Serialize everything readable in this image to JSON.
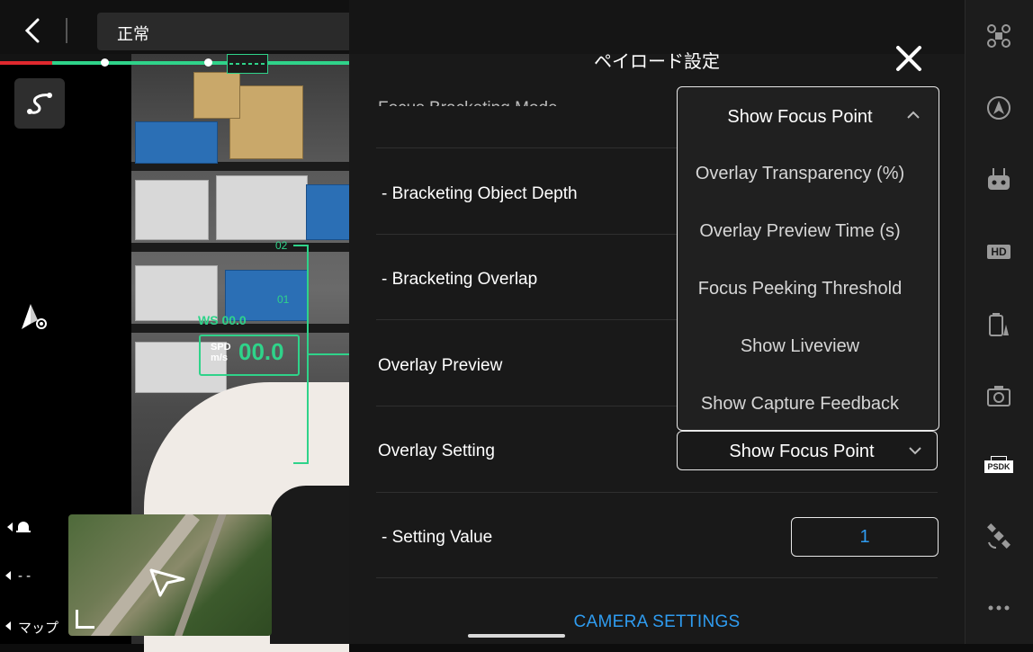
{
  "topbar": {
    "status": "正常"
  },
  "hud": {
    "wind_speed": "WS 00.0",
    "speed_label_line1": "SPD",
    "speed_label_line2": "m/s",
    "speed_value": "00.0",
    "alt_tick_top": "02",
    "alt_tick_mid": "01"
  },
  "left_labels": {
    "dashes": "- -",
    "map": "マップ"
  },
  "modal": {
    "title": "ペイロード設定",
    "rows": {
      "focus_bracketing_mode": "Focus Bracketing Mode",
      "bracketing_object_depth": "- Bracketing Object Depth",
      "bracketing_overlap": "- Bracketing Overlap",
      "overlay_preview": "Overlay Preview",
      "overlay_setting": "Overlay Setting",
      "setting_value": "- Setting Value"
    },
    "dropdown": {
      "selected": "Show Focus Point",
      "options": [
        "Overlay Transparency (%)",
        "Overlay Preview Time (s)",
        "Focus Peeking Threshold",
        "Show Liveview",
        "Show Capture Feedback"
      ]
    },
    "overlay_setting_value": "Show Focus Point",
    "setting_value": "1",
    "camera_settings_link": "CAMERA SETTINGS"
  },
  "colors": {
    "accent_blue": "#2f9cf0",
    "hud_green": "#2fd38a",
    "alert_red": "#e0282e"
  },
  "right_rail": {
    "icons": [
      "drone-icon",
      "autopilot-icon",
      "controller-icon",
      "hd-icon",
      "battery-icon",
      "camera-icon",
      "psdk-icon",
      "satellite-icon",
      "more-icon"
    ],
    "hd_label": "HD",
    "psdk_label": "PSDK"
  }
}
